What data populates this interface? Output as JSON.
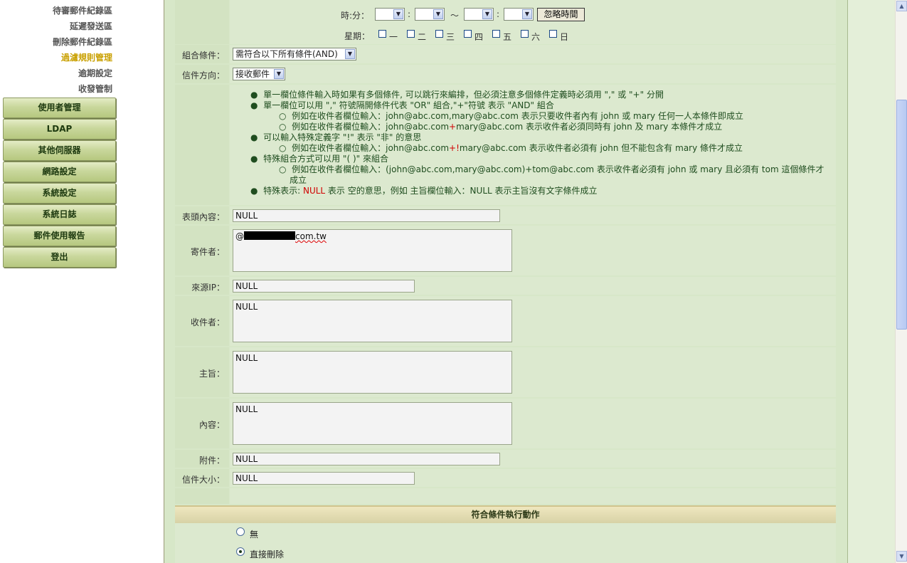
{
  "sidebar": {
    "sublinks": [
      "待審郵件紀錄區",
      "延遲發送區",
      "刪除郵件紀錄區",
      "過濾規則管理",
      "逾期設定",
      "收發管制"
    ],
    "buttons": [
      "使用者管理",
      "LDAP",
      "其他伺服器",
      "網路設定",
      "系統設定",
      "系統日誌",
      "郵件使用報告",
      "登出"
    ]
  },
  "time": {
    "label": "時:分：",
    "sep": ":",
    "tilde": "～",
    "ignore_button": "忽略時間"
  },
  "week": {
    "label": "星期：",
    "days": [
      "一",
      "二",
      "三",
      "四",
      "五",
      "六",
      "日"
    ]
  },
  "condition": {
    "label": "組合條件：",
    "value": "需符合以下所有條件(AND)"
  },
  "direction": {
    "label": "信件方向：",
    "value": "接收郵件"
  },
  "help": {
    "l1": "單一欄位條件輸入時如果有多個條件, 可以跳行來編排，但必須注意多個條件定義時必須用 \",\" 或 \"+\" 分開",
    "l2": "單一欄位可以用 \",\" 符號隔開條件代表 \"OR\" 組合,\"+\"符號 表示 \"AND\" 組合",
    "l3": "例如在收件者欄位輸入：john@abc.com,mary@abc.com 表示只要收件者內有 john 或 mary 任何一人本條件即成立",
    "l4a": "例如在收件者欄位輸入：john@abc.com",
    "l4op": "+",
    "l4b": "mary@abc.com 表示收件者必須同時有 john 及 mary 本條件才成立",
    "l5": "可以輸入特殊定義字 \"!\" 表示 \"非\" 的意思",
    "l6a": "例如在收件者欄位輸入：john@abc.com",
    "l6op": "+!",
    "l6b": "mary@abc.com 表示收件者必須有 john 但不能包含有 mary 條件才成立",
    "l7": "特殊組合方式可以用 \"( )\" 來組合",
    "l8a": "例如在收件者欄位輸入：(john@abc.com,mary@abc.com)+tom@abc.com 表示收件者必須有 john 或 mary 且必須有 tom 這個條件才",
    "l8b": "成立",
    "l9a": "特殊表示: ",
    "l9null": "NULL",
    "l9b": " 表示 空的意思，例如 主旨欄位輸入：NULL 表示主旨沒有文字條件成立"
  },
  "fields": {
    "header": {
      "label": "表頭內容：",
      "value": "NULL"
    },
    "sender": {
      "label": "寄件者：",
      "prefix": "@",
      "suffix": "com.tw"
    },
    "source_ip": {
      "label": "來源IP：",
      "value": "NULL"
    },
    "recipient": {
      "label": "收件者：",
      "value": "NULL"
    },
    "subject": {
      "label": "主旨：",
      "value": "NULL"
    },
    "content": {
      "label": "內容：",
      "value": "NULL"
    },
    "attachment": {
      "label": "附件：",
      "value": "NULL"
    },
    "size": {
      "label": "信件大小：",
      "value": "NULL"
    }
  },
  "actions": {
    "title": "符合條件執行動作",
    "options": [
      "無",
      "直接刪除"
    ],
    "selected": "直接刪除"
  },
  "colors": {
    "main_bg": "#d7e7c8",
    "active_link": "#c9a000",
    "help_text": "#1f4d1f",
    "highlight_red": "#d00000"
  }
}
